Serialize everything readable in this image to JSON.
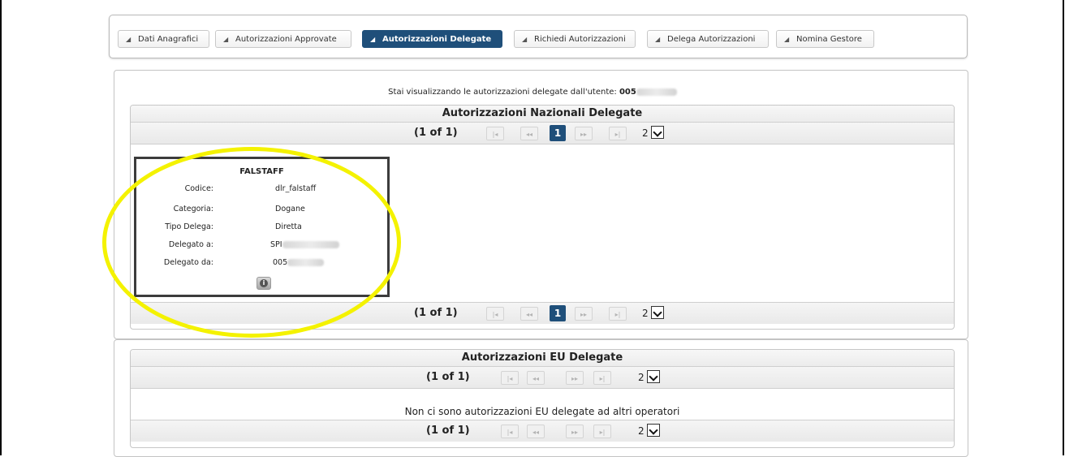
{
  "tabs": [
    {
      "label": "Dati Anagrafici",
      "active": false
    },
    {
      "label": "Autorizzazioni Approvate",
      "active": false
    },
    {
      "label": "Autorizzazioni Delegate",
      "active": true
    },
    {
      "label": "Richiedi Autorizzazioni",
      "active": false
    },
    {
      "label": "Delega Autorizzazioni",
      "active": false
    },
    {
      "label": "Nomina Gestore",
      "active": false
    }
  ],
  "intro": {
    "text": "Stai visualizzando le autorizzazioni delegate dall'utente:",
    "user_prefix": "005"
  },
  "national": {
    "title": "Autorizzazioni Nazionali Delegate",
    "pager": {
      "count": "(1 of 1)",
      "page": "1",
      "rows": "2"
    },
    "card": {
      "title": "FALSTAFF",
      "fields": [
        {
          "key": "Codice:",
          "value": "dlr_falstaff"
        },
        {
          "key": "Categoria:",
          "value": "Dogane"
        },
        {
          "key": "Tipo Delega:",
          "value": "Diretta"
        },
        {
          "key": "Delegato a:",
          "value": "SPI"
        },
        {
          "key": "Delegato da:",
          "value": "005"
        }
      ]
    }
  },
  "eu": {
    "title": "Autorizzazioni EU Delegate",
    "pager": {
      "count": "(1 of 1)",
      "rows": "2"
    },
    "empty_message": "Non ci sono autorizzazioni EU delegate ad altri operatori"
  },
  "colors": {
    "accent": "#1f4f7a",
    "highlight": "#f4f200"
  },
  "icons": {
    "tab": "triangle-icon",
    "first": "first-page-icon",
    "prev": "prev-page-icon",
    "next": "next-page-icon",
    "last": "last-page-icon",
    "info": "info-icon"
  }
}
